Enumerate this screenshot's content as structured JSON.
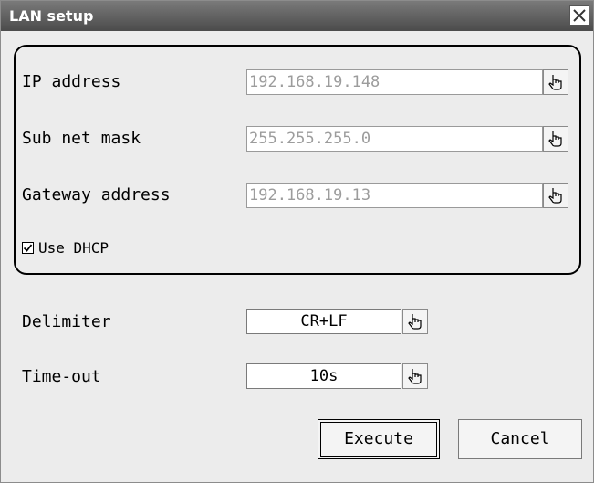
{
  "window": {
    "title": "LAN setup"
  },
  "network": {
    "ip_label": "IP address",
    "ip_value": "192.168.19.148",
    "subnet_label": "Sub net mask",
    "subnet_value": "255.255.255.0",
    "gateway_label": "Gateway address",
    "gateway_value": "192.168.19.13",
    "dhcp_label": "Use DHCP",
    "dhcp_checked": true
  },
  "settings": {
    "delimiter_label": "Delimiter",
    "delimiter_value": "CR+LF",
    "timeout_label": "Time-out",
    "timeout_value": "10s"
  },
  "buttons": {
    "execute": "Execute",
    "cancel": "Cancel"
  },
  "icons": {
    "close": "close-icon",
    "pointer": "hand-pointer-icon",
    "check": "checkmark-icon"
  }
}
